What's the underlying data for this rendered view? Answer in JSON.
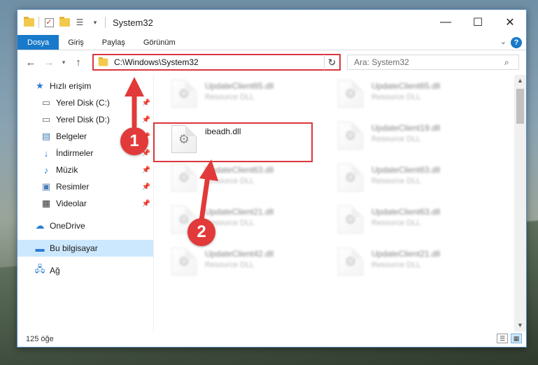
{
  "window": {
    "title": "System32",
    "controls": {
      "minimize": "—",
      "maximize": "☐",
      "close": "✕"
    }
  },
  "ribbon": {
    "tabs": [
      "Dosya",
      "Giriş",
      "Paylaş",
      "Görünüm"
    ],
    "help": "?"
  },
  "address": {
    "path": "C:\\Windows\\System32",
    "search_placeholder": "Ara: System32"
  },
  "sidebar": {
    "quick_access": "Hızlı erişim",
    "pinned": [
      "Yerel Disk (C:)",
      "Yerel Disk (D:)",
      "Belgeler",
      "İndirmeler",
      "Müzik",
      "Resimler",
      "Videolar"
    ],
    "onedrive": "OneDrive",
    "this_pc": "Bu bilgisayar",
    "network": "Ağ"
  },
  "files": {
    "left": [
      {
        "name": "UpdateClient65.dll",
        "type": "Resource DLL"
      },
      {
        "name": "ibeadh.dll",
        "type": ""
      },
      {
        "name": "UpdateClient63.dll",
        "type": "Resource DLL"
      },
      {
        "name": "UpdateClient21.dll",
        "type": "Resource DLL"
      },
      {
        "name": "UpdateClient42.dll",
        "type": "Resource DLL"
      }
    ],
    "right": [
      {
        "name": "UpdateClient65.dll",
        "type": "Resource DLL"
      },
      {
        "name": "UpdateClient19.dll",
        "type": "Resource DLL"
      },
      {
        "name": "UpdateClient63.dll",
        "type": "Resource DLL"
      },
      {
        "name": "UpdateClient63.dll",
        "type": "Resource DLL"
      },
      {
        "name": "UpdateClient21.dll",
        "type": "Resource DLL"
      }
    ]
  },
  "status": {
    "count": "125 öğe"
  },
  "annotations": {
    "step1": "1",
    "step2": "2",
    "color": "#e23a3a"
  }
}
